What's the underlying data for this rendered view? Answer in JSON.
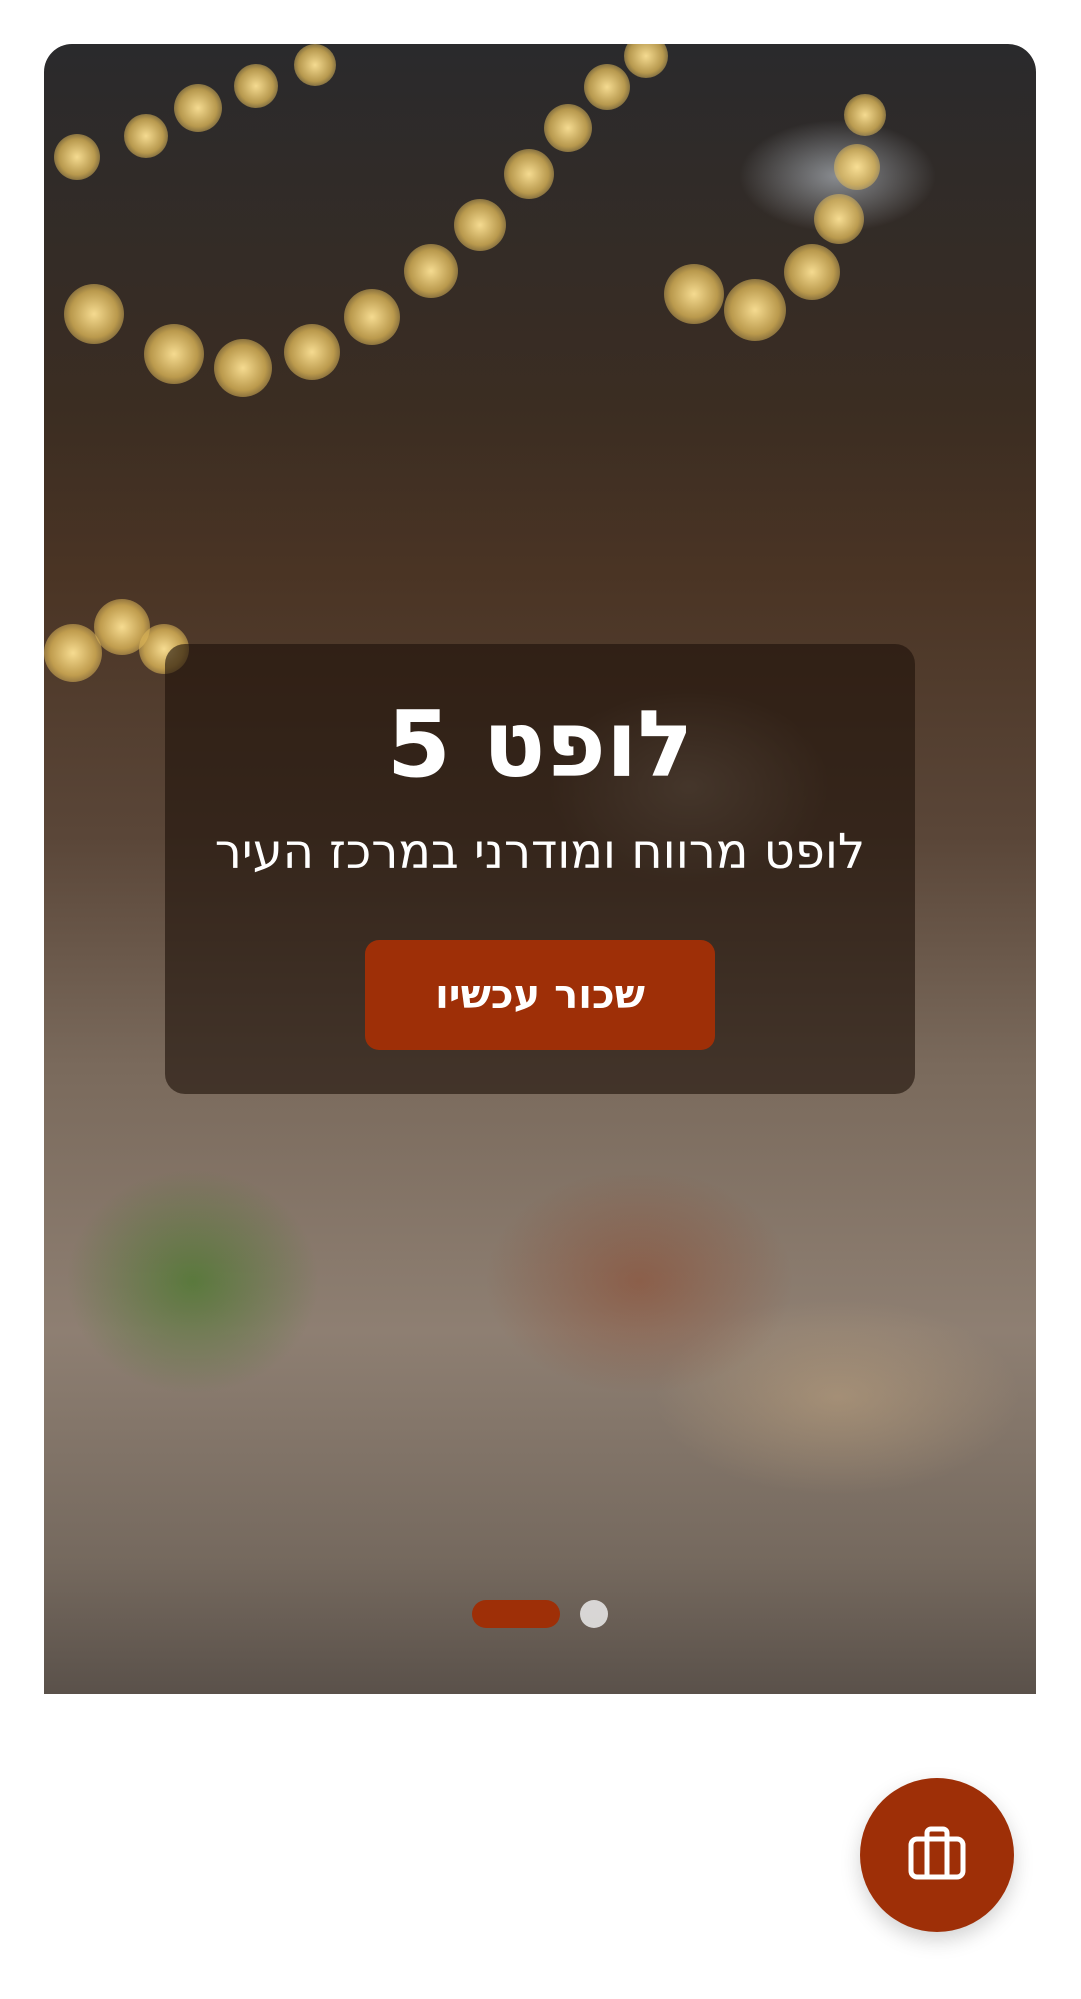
{
  "hero": {
    "title": "לופט 5",
    "subtitle": "לופט מרווח ומודרני במרכז העיר",
    "cta_label": "שכור עכשיו"
  },
  "carousel": {
    "slide_count": 2,
    "active_index": 0
  },
  "fab": {
    "icon": "briefcase-icon"
  },
  "colors": {
    "accent": "#9e2f07",
    "card_overlay": "rgba(30,18,10,0.62)",
    "inactive_dot": "#ebebeb"
  }
}
